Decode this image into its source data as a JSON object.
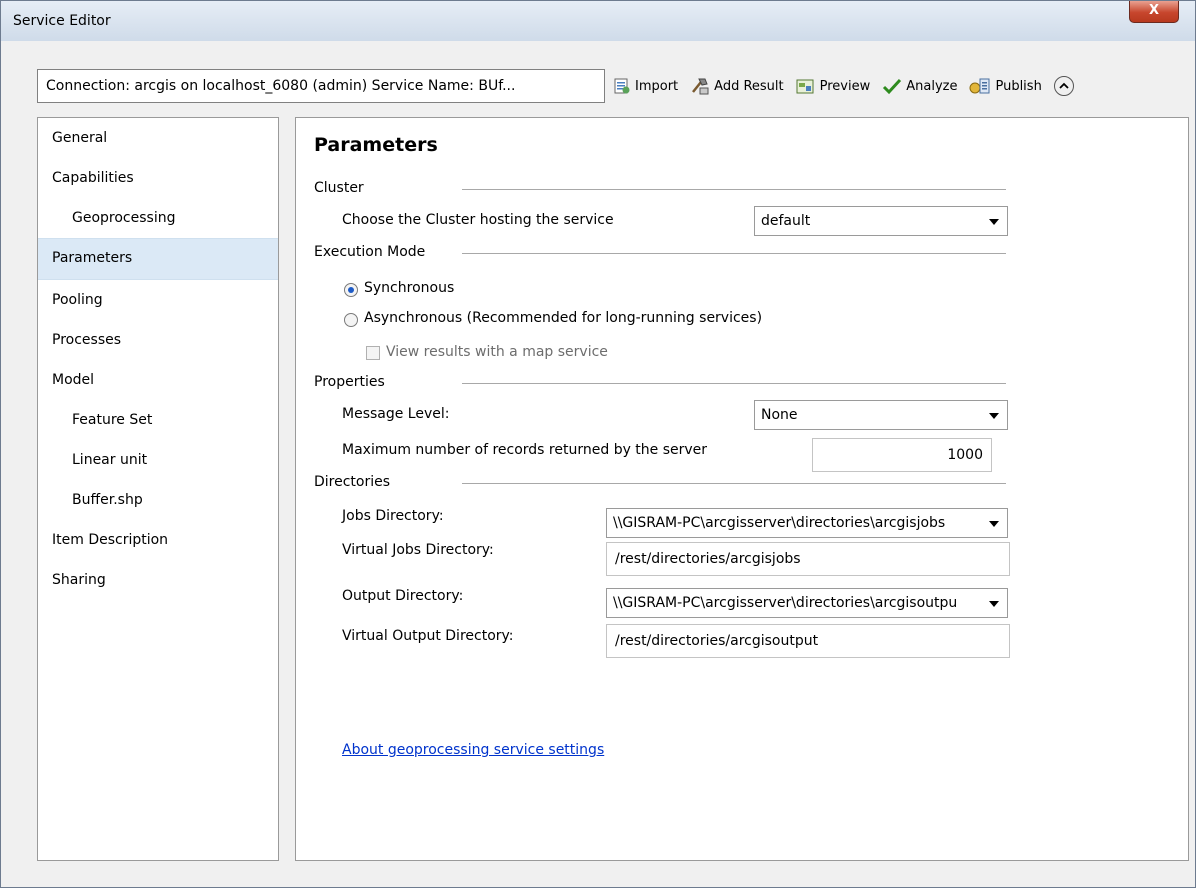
{
  "window": {
    "title": "Service Editor",
    "close_glyph": "X"
  },
  "header": {
    "connection_text": "Connection: arcgis on localhost_6080 (admin)  Service Name: BUf...",
    "toolbar": {
      "import": "Import",
      "add_result": "Add Result",
      "preview": "Preview",
      "analyze": "Analyze",
      "publish": "Publish"
    }
  },
  "nav": {
    "items": [
      {
        "label": "General"
      },
      {
        "label": "Capabilities"
      },
      {
        "label": "Geoprocessing"
      },
      {
        "label": "Parameters"
      },
      {
        "label": "Pooling"
      },
      {
        "label": "Processes"
      },
      {
        "label": "Model"
      },
      {
        "label": "Feature Set"
      },
      {
        "label": "Linear unit"
      },
      {
        "label": "Buffer.shp"
      },
      {
        "label": "Item Description"
      },
      {
        "label": "Sharing"
      }
    ],
    "selected": "Parameters"
  },
  "main": {
    "title": "Parameters",
    "cluster": {
      "heading": "Cluster",
      "label": "Choose the Cluster hosting the service",
      "value": "default"
    },
    "execution": {
      "heading": "Execution Mode",
      "sync_label": "Synchronous",
      "async_label": "Asynchronous (Recommended for long-running services)",
      "map_service_label": "View results with a map service",
      "selected": "Synchronous",
      "map_service_checked": false
    },
    "properties": {
      "heading": "Properties",
      "message_level_label": "Message Level:",
      "message_level_value": "None",
      "max_records_label": "Maximum number of records returned by the server",
      "max_records_value": "1000"
    },
    "directories": {
      "heading": "Directories",
      "jobs_label": "Jobs Directory:",
      "jobs_value": "\\\\GISRAM-PC\\arcgisserver\\directories\\arcgisjobs",
      "virtual_jobs_label": "Virtual Jobs Directory:",
      "virtual_jobs_value": "/rest/directories/arcgisjobs",
      "output_label": "Output Directory:",
      "output_value": "\\\\GISRAM-PC\\arcgisserver\\directories\\arcgisoutpu",
      "virtual_output_label": "Virtual Output Directory:",
      "virtual_output_value": "/rest/directories/arcgisoutput"
    },
    "help_link": "About geoprocessing service settings"
  },
  "icons": [
    "import-icon",
    "add-result-icon",
    "preview-icon",
    "analyze-icon",
    "publish-icon",
    "collapse-icon",
    "close-icon"
  ]
}
